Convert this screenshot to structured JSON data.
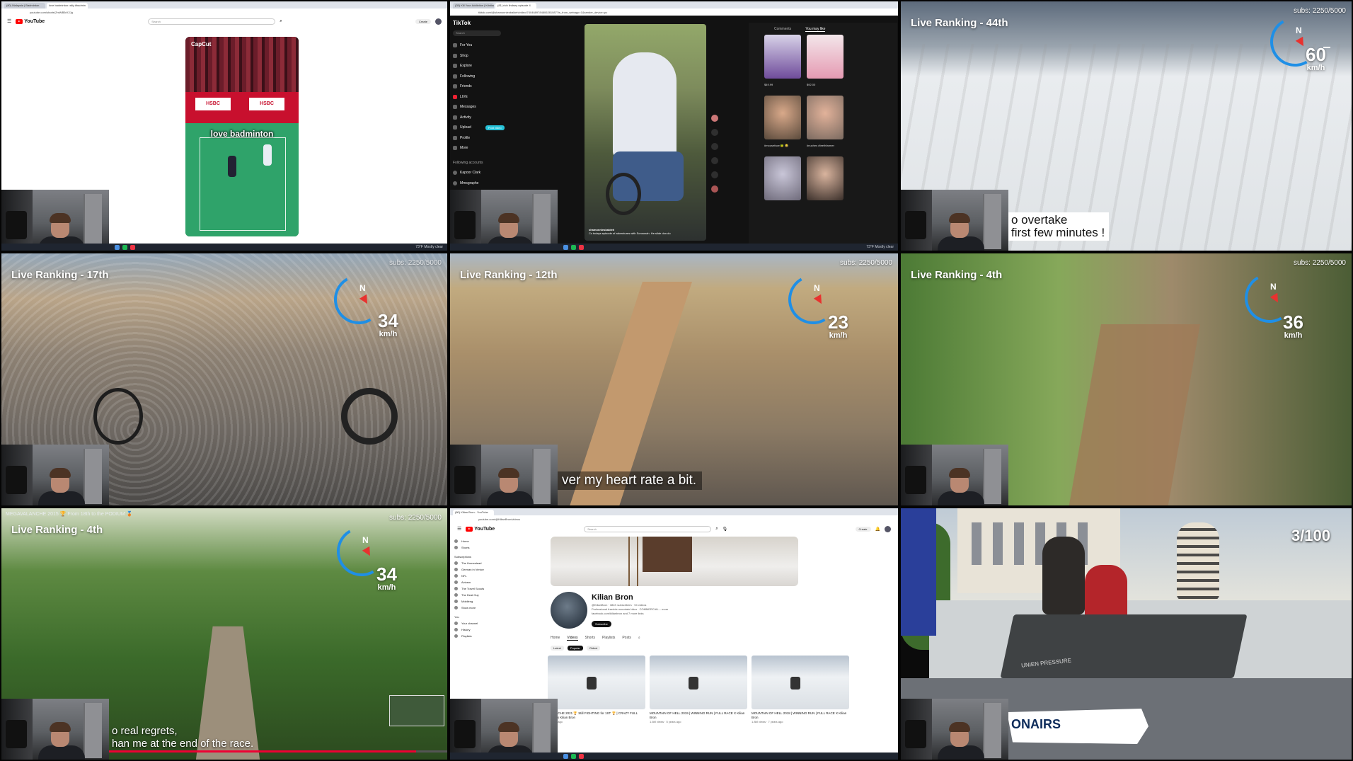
{
  "tile1": {
    "tabs": [
      "(80) Malaysia | Badminton",
      "love badminton rally #badmin"
    ],
    "url": "youtube.com/shorts/ZmWB5rX2Jg",
    "logo": "YouTube",
    "search_placeholder": "Search",
    "create": "Create",
    "short_brand": "CapCut",
    "sponsor1": "HSBC",
    "sponsor2": "HSBC",
    "caption": "love badminton",
    "taskbar_weather": "73°F Mostly clear"
  },
  "tile2": {
    "tabs": [
      "(35) Kill Your Addiction | Kristian Ha",
      "(81) rich lindsey episode 4"
    ],
    "url": "tiktok.com/@shamonnlesbaldeh/video/7404689784806281087?is_from_webapp=1&sender_device=pc",
    "brand": "TikTok",
    "search_placeholder": "Search",
    "nav": [
      "For You",
      "Shop",
      "Explore",
      "Following",
      "Friends",
      "LIVE",
      "Messages",
      "Activity",
      "Upload",
      "Profile",
      "More"
    ],
    "post_video": "Post video",
    "following_accounts": "Following accounts",
    "accounts": [
      "Kapoor Clark",
      "Mmsgraphe"
    ],
    "right_tabs": [
      "Comments",
      "You may like"
    ],
    "prices": [
      "$49.99",
      "$92.00"
    ],
    "captions": [
      "#mouseface 🐸 😂",
      "#nuches #teethfarmer"
    ],
    "video_handle": "shamonnlesbaldeh",
    "video_caption": "Cc todays episode of adventures with Sonsonah. He slide don do"
  },
  "tile3": {
    "rank": "Live Ranking - 44th",
    "subs": "subs: 2250/5000",
    "speed": "60",
    "unit": "km/h",
    "compass": "N",
    "subtitle_line1": "o overtake",
    "subtitle_line2": "first few minutes !"
  },
  "tile4": {
    "rank": "Live Ranking - 17th",
    "subs": "subs: 2250/5000",
    "speed": "34",
    "unit": "km/h",
    "compass": "N"
  },
  "tile5": {
    "rank": "Live Ranking - 12th",
    "subs": "subs: 2250/5000",
    "speed": "23",
    "unit": "km/h",
    "compass": "N",
    "subtitle": "ver my heart rate a bit."
  },
  "tile6": {
    "rank": "Live Ranking - 4th",
    "subs": "subs: 2250/5000",
    "speed": "36",
    "unit": "km/h",
    "compass": "N"
  },
  "tile7": {
    "title_bar": "MEGAVALANCHE 2015 🏆 From 18th to the PODIUM 🥉",
    "rank": "Live Ranking - 4th",
    "subs": "subs: 2250/5000",
    "speed": "34",
    "unit": "km/h",
    "compass": "N",
    "subtitle_line1": "o real regrets,",
    "subtitle_line2": "han me at the end of the race."
  },
  "tile8": {
    "tab": "(80) Kilian Bron - YouTube",
    "url": "youtube.com/@KilianBron/videos",
    "logo": "YouTube",
    "search_placeholder": "Search",
    "create": "Create",
    "sidebar": [
      "Home",
      "Shorts",
      "Subscriptions",
      "The Homestead",
      "German in Venice",
      "NFL",
      "Aviosm",
      "The Travel Scouts",
      "The Deal Guy",
      "Mobileng",
      "Show more",
      "You",
      "Your channel",
      "History",
      "Playlists"
    ],
    "channel_name": "Kilian Bron",
    "channel_meta": "@KilianBron · 381K subscribers · 94 videos",
    "channel_desc": "Professional freeride mountain biker · COMMERCIAL... more",
    "channel_link": "facebook.com/kilianbron and 7 more links",
    "subscribe": "Subscribe",
    "tabs": [
      "Home",
      "Videos",
      "Shorts",
      "Playlists",
      "Posts"
    ],
    "chips": [
      "Latest",
      "Popular",
      "Oldest"
    ],
    "videos": [
      {
        "title": "VALANCHE 2021 🏆 Still FIGHTING for 1ST 🏆 | CRAZY FULL RACE x Kilian Bron",
        "meta": "4 years ago"
      },
      {
        "title": "MOUNTAIN OF HELL 2019 | WINNING RUN | FULL RACE X Kilian Bron",
        "meta": "1.6M views · 5 years ago"
      },
      {
        "title": "MOUNTAIN OF HELL 2018 | WINNING RUN | FULL RACE X Kilian Bron",
        "meta": "1.8M views · 7 years ago"
      }
    ]
  },
  "tile9": {
    "counter": "3/100",
    "badge": "ONAIRS",
    "barrow_text": "UNIEN PRESSURE"
  },
  "colors": {
    "compass_blue": "#1f8fe6",
    "compass_red": "#e8322f",
    "youtube_red": "#ff0000",
    "tiktok_cyan": "#25c2d8"
  }
}
